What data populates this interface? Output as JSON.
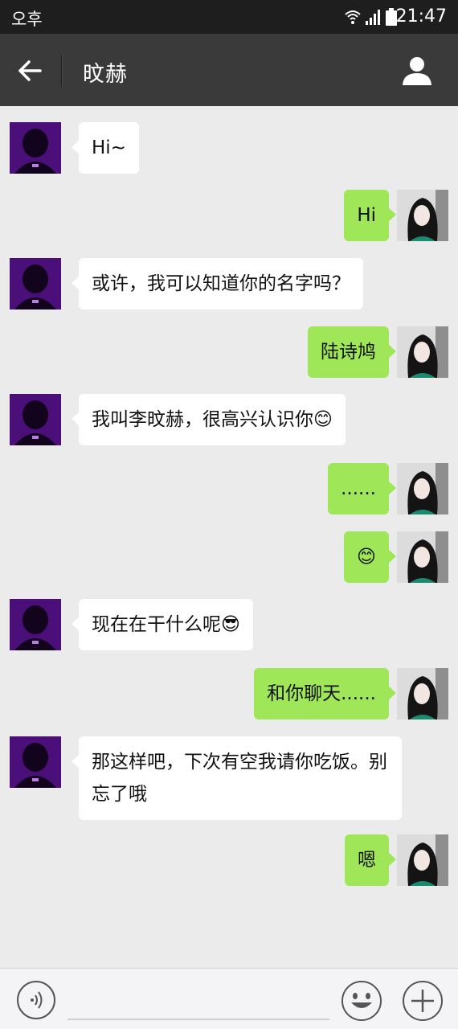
{
  "status_bar": {
    "carrier": "오후",
    "time": "21:47",
    "icons": [
      "wifi-icon",
      "signal-icon",
      "battery-icon"
    ]
  },
  "header": {
    "title": "旼赫",
    "back_icon": "arrow-left-icon",
    "profile_icon": "person-icon"
  },
  "messages": [
    {
      "side": "left",
      "text": "Hi~"
    },
    {
      "side": "right",
      "text": "Hi"
    },
    {
      "side": "left",
      "text": "或许，我可以知道你的名字吗？"
    },
    {
      "side": "right",
      "text": "陆诗鸠"
    },
    {
      "side": "left",
      "text": "我叫李旼赫，很高兴认识你😊"
    },
    {
      "side": "right",
      "text": "......"
    },
    {
      "side": "right",
      "text": "😊"
    },
    {
      "side": "left",
      "text": "现在在干什么呢😎"
    },
    {
      "side": "right",
      "text": "和你聊天......"
    },
    {
      "side": "left",
      "text": "那这样吧，下次有空我请你吃饭。别忘了哦"
    },
    {
      "side": "right",
      "text": "嗯"
    }
  ],
  "input_bar": {
    "voice_icon": "voice-icon",
    "emoji_icon": "smiley-icon",
    "more_icon": "plus-icon"
  },
  "colors": {
    "header_bg": "#3a3a3a",
    "status_bg": "#1e1e1e",
    "chat_bg": "#ebebeb",
    "sent_bubble": "#9fe658",
    "received_bubble": "#ffffff"
  }
}
